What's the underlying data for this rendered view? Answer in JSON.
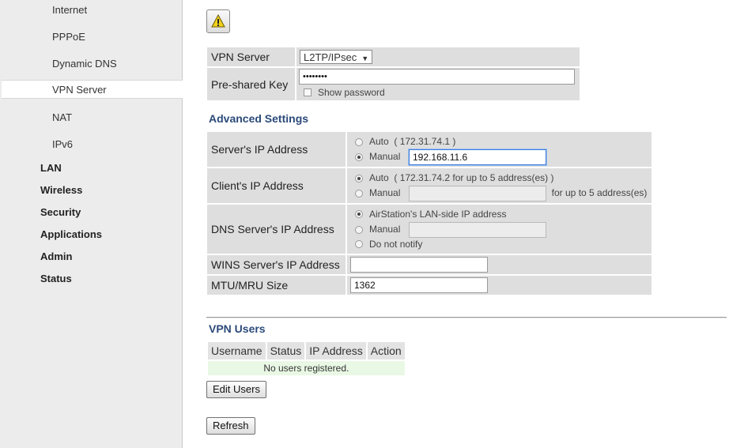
{
  "sidebar": {
    "sub_items": [
      {
        "label": "Internet"
      },
      {
        "label": "PPPoE"
      },
      {
        "label": "Dynamic DNS"
      },
      {
        "label": "VPN Server"
      },
      {
        "label": "NAT"
      },
      {
        "label": "IPv6"
      }
    ],
    "main_items": [
      {
        "label": "LAN"
      },
      {
        "label": "Wireless"
      },
      {
        "label": "Security"
      },
      {
        "label": "Applications"
      },
      {
        "label": "Admin"
      },
      {
        "label": "Status"
      }
    ],
    "active_item": "VPN Server"
  },
  "warning_icon": "warning-triangle-icon",
  "vpn": {
    "server_label": "VPN Server",
    "server_value": "L2TP/IPsec",
    "psk_label": "Pre-shared Key",
    "psk_value": "••••••••",
    "show_password_label": "Show password"
  },
  "advanced": {
    "title": "Advanced Settings",
    "server_ip": {
      "label": "Server's IP Address",
      "auto_label": "Auto",
      "auto_value": "( 172.31.74.1 )",
      "manual_label": "Manual",
      "manual_value": "192.168.11.6",
      "selected": "Manual"
    },
    "client_ip": {
      "label": "Client's IP Address",
      "auto_label": "Auto",
      "auto_value": "( 172.31.74.2 for up to 5 address(es) )",
      "manual_label": "Manual",
      "manual_value": "",
      "manual_suffix": "for up to 5 address(es)",
      "selected": "Auto"
    },
    "dns_ip": {
      "label": "DNS Server's IP Address",
      "opt1_label": "AirStation's LAN-side IP address",
      "manual_label": "Manual",
      "manual_value": "",
      "opt3_label": "Do not notify",
      "selected": "AirStation's LAN-side IP address"
    },
    "wins": {
      "label": "WINS Server's IP Address",
      "value": ""
    },
    "mtu": {
      "label": "MTU/MRU Size",
      "value": "1362"
    }
  },
  "users": {
    "title": "VPN Users",
    "columns": [
      "Username",
      "Status",
      "IP Address",
      "Action"
    ],
    "empty_message": "No users registered.",
    "edit_button": "Edit Users"
  },
  "refresh_button": "Refresh",
  "colors": {
    "section_title": "#2b4a7a",
    "empty_row": "#e9f8e4",
    "sidebar_bg": "#ececec"
  }
}
